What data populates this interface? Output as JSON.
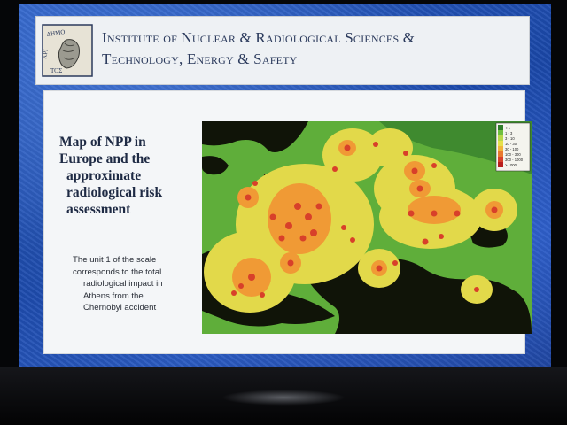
{
  "header": {
    "title_line1": "Institute of Nuclear & Radiological Sciences &",
    "title_line2": "Technology, Energy & Safety",
    "logo_lettering": "ΔΗΜΟΚΡΙΤΟΣ"
  },
  "slide": {
    "heading_lines": [
      "Map of NPP in",
      "Europe and  the",
      "approximate",
      "radiological risk",
      "assessment"
    ],
    "note_lines": [
      "The unit 1 of the scale",
      "corresponds to the total",
      "radiological impact in",
      "Athens from the",
      "Chernobyl accident"
    ]
  },
  "legend": {
    "labels": [
      "< 1",
      "1 - 3",
      "3 - 10",
      "10 - 30",
      "30 - 100",
      "100 - 300",
      "300 - 1000",
      "> 1000"
    ],
    "colors": [
      "#2f7d2a",
      "#6fbf3f",
      "#b8d84a",
      "#e6e04a",
      "#f0b43a",
      "#e8782e",
      "#d8402a",
      "#b81e1e"
    ]
  },
  "colors": {
    "background_green": "#5fae3a",
    "land_black": "#101408",
    "zone_yellow": "#e2d94a",
    "zone_orange": "#f09a35",
    "zone_red": "#d8402a"
  }
}
